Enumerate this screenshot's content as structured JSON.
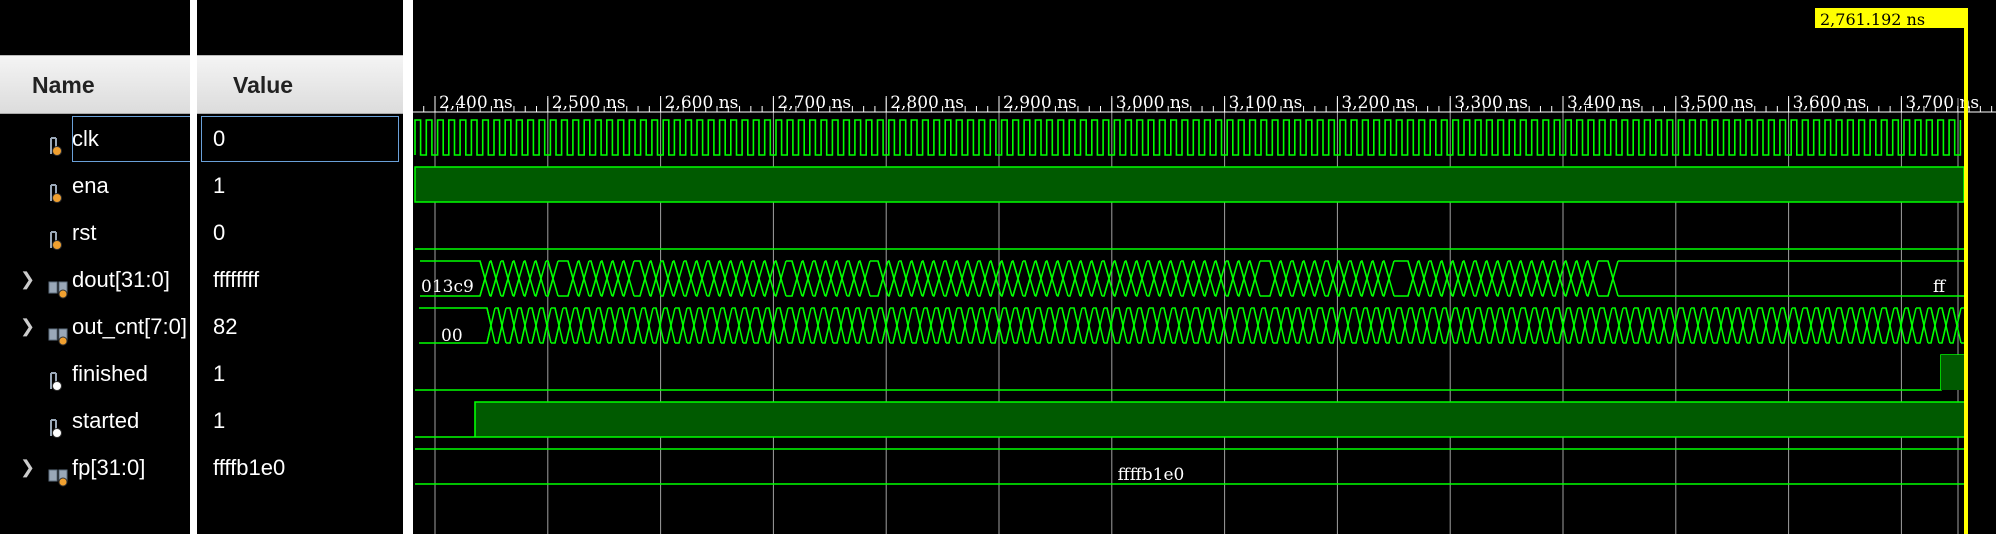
{
  "columns": {
    "name_header": "Name",
    "value_header": "Value"
  },
  "signals": [
    {
      "name": "clk",
      "value": "0",
      "kind": "bit",
      "expandable": false,
      "icon": "bit-signal-icon"
    },
    {
      "name": "ena",
      "value": "1",
      "kind": "bit",
      "expandable": false,
      "icon": "bit-signal-icon"
    },
    {
      "name": "rst",
      "value": "0",
      "kind": "bit",
      "expandable": false,
      "icon": "bit-signal-icon"
    },
    {
      "name": "dout[31:0]",
      "value": "ffffffff",
      "kind": "bus",
      "expandable": true,
      "icon": "bus-signal-icon"
    },
    {
      "name": "out_cnt[7:0]",
      "value": "82",
      "kind": "bus",
      "expandable": true,
      "icon": "bus-signal-icon"
    },
    {
      "name": "finished",
      "value": "1",
      "kind": "bit",
      "expandable": false,
      "icon": "bit-signal-icon"
    },
    {
      "name": "started",
      "value": "1",
      "kind": "bit",
      "expandable": false,
      "icon": "bit-signal-icon"
    },
    {
      "name": "fp[31:0]",
      "value": "ffffb1e0",
      "kind": "bus",
      "expandable": true,
      "icon": "bus-signal-icon"
    }
  ],
  "timeline": {
    "ticks": [
      "2,400 ns",
      "2,500 ns",
      "2,600 ns",
      "2,700 ns",
      "2,800 ns",
      "2,900 ns",
      "3,000 ns",
      "3,100 ns",
      "3,200 ns",
      "3,300 ns",
      "3,400 ns",
      "3,500 ns",
      "3,600 ns",
      "3,700 ns"
    ],
    "cursor_label": "2,761.192 ns"
  },
  "wave_labels": {
    "dout_start": "013c9",
    "dout_end": "ff",
    "out_cnt_start": "00",
    "fp": "ffffb1e0"
  },
  "colors": {
    "wave": "#00ff00",
    "fill": "#005a00",
    "cursor": "#ffff00",
    "grid": "#a0a0a0",
    "selection": "#6aa0d8"
  }
}
